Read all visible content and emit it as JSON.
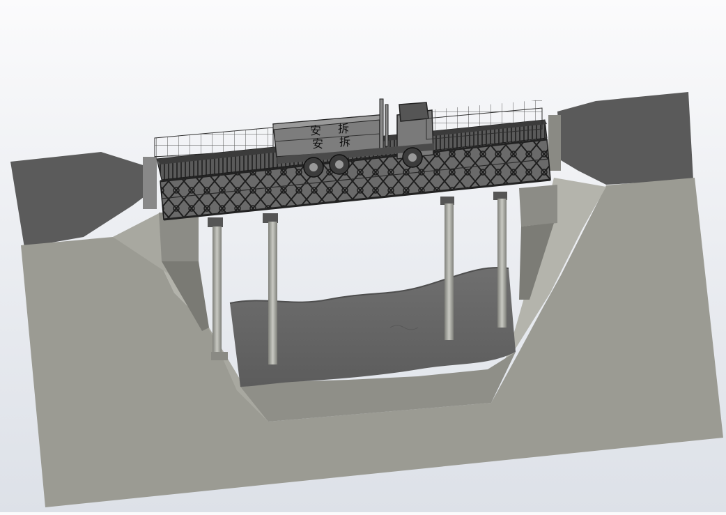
{
  "scene": {
    "truck": {
      "cargo_markings": [
        "安",
        "拆",
        "安",
        "拆"
      ]
    },
    "colors": {
      "background_top": "#fbfbfc",
      "background_bottom": "#dde1e8",
      "terrain_top": "#9a9a92",
      "terrain_slope": "#b2b2aa",
      "terrain_dark": "#5e5e5e",
      "water": "#6a6a6a",
      "steel": "#3a3a3a",
      "pier": "#a9aaa3"
    },
    "icons": [
      "bridge-icon",
      "truck-icon",
      "pier-icon",
      "river-icon"
    ]
  }
}
